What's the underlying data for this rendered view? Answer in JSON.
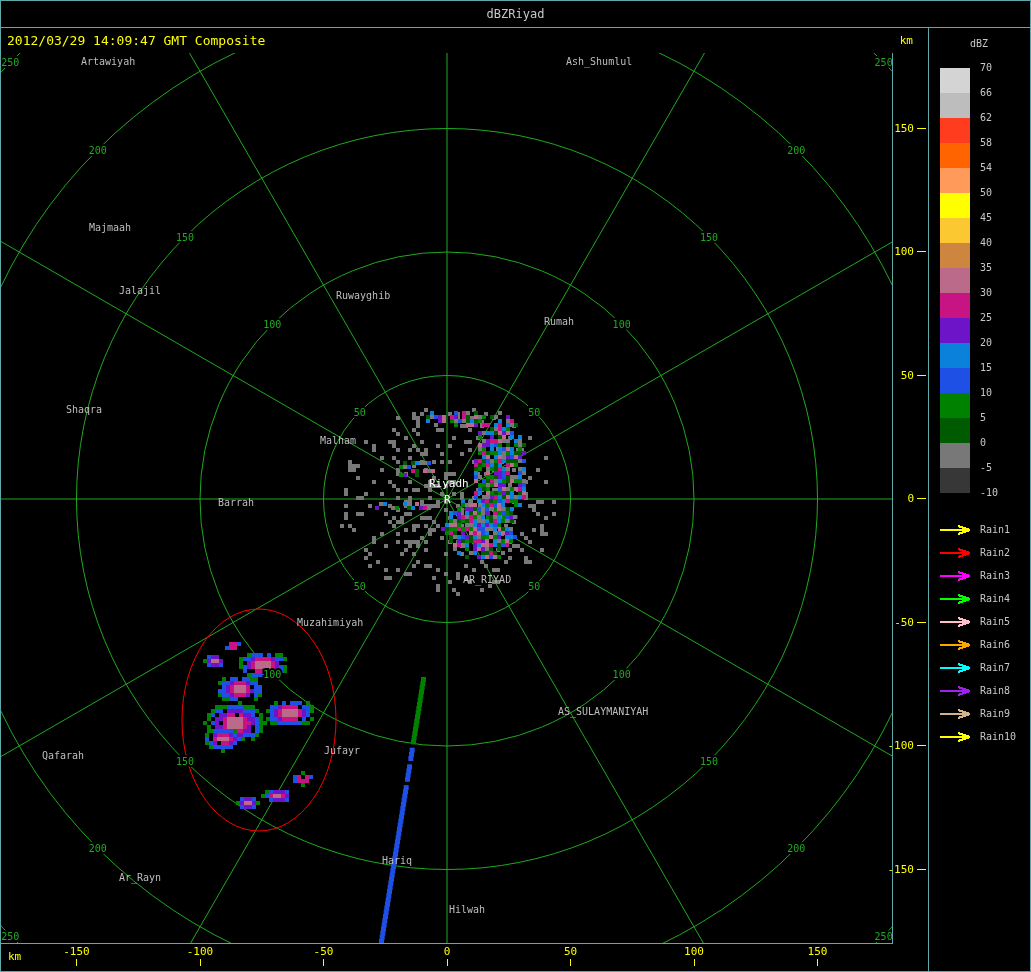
{
  "window": {
    "title": "dBZRiyad"
  },
  "header": {
    "timestamp": "2012/03/29 14:09:47 GMT Composite",
    "unit": "km"
  },
  "map": {
    "range_rings": [
      {
        "labels": [
          "50",
          "50",
          "50",
          "50"
        ]
      },
      {
        "labels": [
          "100",
          "100",
          "100",
          "100"
        ]
      },
      {
        "labels": [
          "150",
          "150",
          "150",
          "150"
        ]
      },
      {
        "labels": [
          "200",
          "200",
          "200",
          "200"
        ]
      },
      {
        "labels": [
          "250",
          "250",
          "250",
          "250"
        ]
      }
    ],
    "places": [
      {
        "name": "Artawiyah",
        "kind": "city"
      },
      {
        "name": "Ash_Shumlul",
        "kind": "city"
      },
      {
        "name": "Majmaah",
        "kind": "city"
      },
      {
        "name": "Jalajil",
        "kind": "city"
      },
      {
        "name": "Ruwayghib",
        "kind": "city"
      },
      {
        "name": "Rumah",
        "kind": "city"
      },
      {
        "name": "Shaqra",
        "kind": "city"
      },
      {
        "name": "Malham",
        "kind": "city"
      },
      {
        "name": "Riyadh",
        "kind": "station"
      },
      {
        "name": "R",
        "kind": "station"
      },
      {
        "name": "Barrah",
        "kind": "city"
      },
      {
        "name": "AR_RIYAD",
        "kind": "city"
      },
      {
        "name": "Muzahimiyah",
        "kind": "city"
      },
      {
        "name": "AS_SULAYMANIYAH",
        "kind": "city"
      },
      {
        "name": "Qafarah",
        "kind": "city"
      },
      {
        "name": "Jufayr",
        "kind": "city"
      },
      {
        "name": "Hariq",
        "kind": "city"
      },
      {
        "name": "Ar_Rayn",
        "kind": "city"
      },
      {
        "name": "Hilwah",
        "kind": "city"
      }
    ]
  },
  "y_axis": {
    "ticks": [
      "150",
      "100",
      "50",
      "0",
      "-50",
      "-100",
      "-150"
    ]
  },
  "x_axis": {
    "unit": "km",
    "ticks": [
      "-150",
      "-100",
      "-50",
      "0",
      "50",
      "100",
      "150"
    ]
  },
  "legend": {
    "title": "dBZ",
    "bins": [
      {
        "color": "#d4d4d4"
      },
      {
        "color": "#bdbdbd"
      },
      {
        "color": "#ff3c1e"
      },
      {
        "color": "#ff6400"
      },
      {
        "color": "#ff9a5a"
      },
      {
        "color": "#ffff00"
      },
      {
        "color": "#fbc832"
      },
      {
        "color": "#cd853f"
      },
      {
        "color": "#bc6a8a"
      },
      {
        "color": "#c81482"
      },
      {
        "color": "#6e14c8"
      },
      {
        "color": "#0a82dc"
      },
      {
        "color": "#1e50e6"
      },
      {
        "color": "#008200"
      },
      {
        "color": "#005a00"
      },
      {
        "color": "#787878"
      },
      {
        "color": "#373737"
      }
    ],
    "labels": [
      "70",
      "66",
      "62",
      "58",
      "54",
      "50",
      "45",
      "40",
      "35",
      "30",
      "25",
      "20",
      "15",
      "10",
      "5",
      "0",
      "-5",
      "-10"
    ],
    "tracks": [
      {
        "label": "Rain1",
        "color": "#ffff00"
      },
      {
        "label": "Rain2",
        "color": "#ff0000"
      },
      {
        "label": "Rain3",
        "color": "#ff00ff"
      },
      {
        "label": "Rain4",
        "color": "#00ff00"
      },
      {
        "label": "Rain5",
        "color": "#ffc0cb"
      },
      {
        "label": "Rain6",
        "color": "#ffa500"
      },
      {
        "label": "Rain7",
        "color": "#00ffff"
      },
      {
        "label": "Rain8",
        "color": "#a020f0"
      },
      {
        "label": "Rain9",
        "color": "#d2b48c"
      },
      {
        "label": "Rain10",
        "color": "#ffff00"
      }
    ]
  }
}
